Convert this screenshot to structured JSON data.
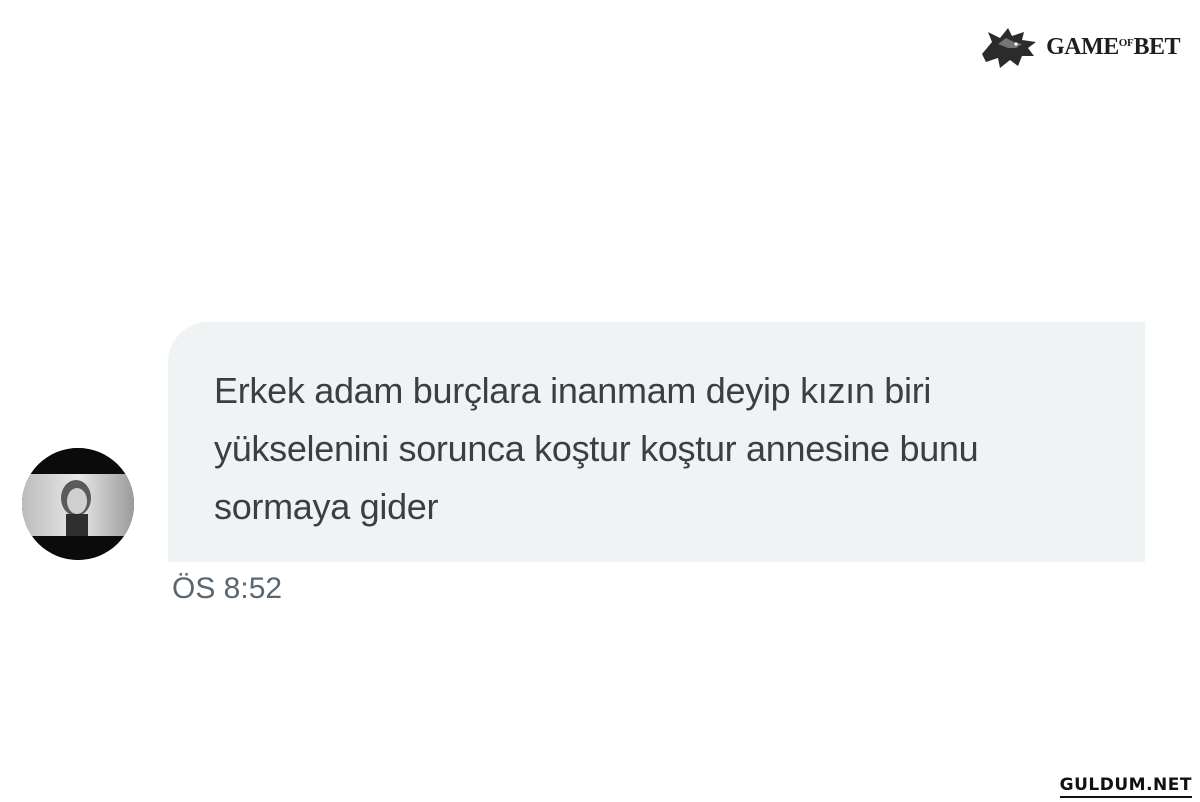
{
  "watermark": {
    "brand_name": "GAMEofBET",
    "brand_part_1": "GAME",
    "brand_part_2": "OF",
    "brand_part_3": "BET",
    "icon": "wolf-head-icon"
  },
  "message": {
    "line_1": "Erkek adam burçlara inanmam deyip kızın biri",
    "line_2": "yükselenini sorunca koştur koştur annesine bunu",
    "line_3": "sormaya gider",
    "timestamp": "ÖS 8:52"
  },
  "site_mark": {
    "label": "GULDUM.NET"
  },
  "colors": {
    "bubble_background": "#eff3f4",
    "text": "#3a3f44",
    "timestamp": "#5b6770",
    "background": "#ffffff"
  }
}
